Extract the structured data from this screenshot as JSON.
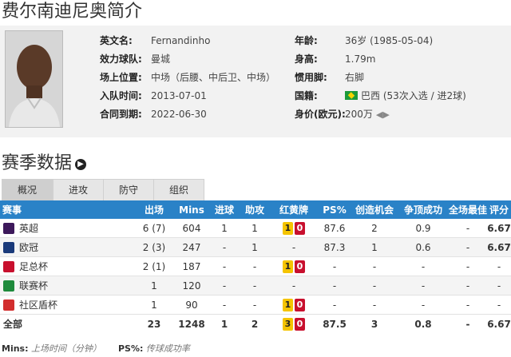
{
  "title": "费尔南迪尼奥简介",
  "profile": {
    "left": [
      {
        "label": "英文名:",
        "value": "Fernandinho"
      },
      {
        "label": "效力球队:",
        "value": "曼城"
      },
      {
        "label": "场上位置:",
        "value": "中场（后腰、中后卫、中场）"
      },
      {
        "label": "入队时间:",
        "value": "2013-07-01"
      },
      {
        "label": "合同到期:",
        "value": "2022-06-30"
      }
    ],
    "right": {
      "age": {
        "label": "年龄:",
        "value": "36岁 (1985-05-04)"
      },
      "height": {
        "label": "身高:",
        "value": "1.79m"
      },
      "foot": {
        "label": "惯用脚:",
        "value": "右脚"
      },
      "nation": {
        "label": "国籍:",
        "value": "巴西 (53次入选 / 进2球)"
      },
      "market": {
        "label": "身价(欧元):",
        "value": "200万"
      }
    },
    "flag_colors": {
      "green": "#1c9a3a",
      "yellow": "#f5d300"
    }
  },
  "season": {
    "title": "赛季数据",
    "tabs": [
      "概况",
      "进攻",
      "防守",
      "组织"
    ],
    "active_tab": 0,
    "headers": [
      "赛事",
      "出场",
      "Mins",
      "进球",
      "助攻",
      "红黄牌",
      "PS%",
      "创造机会",
      "争顶成功",
      "全场最佳",
      "评分"
    ],
    "rows": [
      {
        "comp": "英超",
        "icon": "premier-league-icon",
        "icon_color": "#3d195b",
        "apps": "6 (7)",
        "mins": "604",
        "goals": "1",
        "assists": "1",
        "yellow": "1",
        "red": "0",
        "ps": "87.6",
        "chances": "2",
        "aerial": "0.9",
        "motm": "-",
        "rating": "6.67"
      },
      {
        "comp": "欧冠",
        "icon": "champions-league-icon",
        "icon_color": "#1a3a7a",
        "apps": "2 (3)",
        "mins": "247",
        "goals": "-",
        "assists": "1",
        "yellow": "",
        "red": "",
        "card_text": "-",
        "ps": "87.3",
        "chances": "1",
        "aerial": "0.6",
        "motm": "-",
        "rating": "6.67"
      },
      {
        "comp": "足总杯",
        "icon": "fa-cup-icon",
        "icon_color": "#c8102e",
        "apps": "2 (1)",
        "mins": "187",
        "goals": "-",
        "assists": "-",
        "yellow": "1",
        "red": "0",
        "ps": "-",
        "chances": "-",
        "aerial": "-",
        "motm": "-",
        "rating": "-"
      },
      {
        "comp": "联赛杯",
        "icon": "league-cup-icon",
        "icon_color": "#1e8a3c",
        "apps": "1",
        "mins": "120",
        "goals": "-",
        "assists": "-",
        "yellow": "",
        "red": "",
        "card_text": "-",
        "ps": "-",
        "chances": "-",
        "aerial": "-",
        "motm": "-",
        "rating": "-"
      },
      {
        "comp": "社区盾杯",
        "icon": "community-shield-icon",
        "icon_color": "#d22e2e",
        "apps": "1",
        "mins": "90",
        "goals": "-",
        "assists": "-",
        "yellow": "1",
        "red": "0",
        "ps": "-",
        "chances": "-",
        "aerial": "-",
        "motm": "-",
        "rating": "-"
      }
    ],
    "total": {
      "comp": "全部",
      "apps": "23",
      "mins": "1248",
      "goals": "1",
      "assists": "2",
      "yellow": "3",
      "red": "0",
      "ps": "87.5",
      "chances": "3",
      "aerial": "0.8",
      "motm": "-",
      "rating": "6.67"
    }
  },
  "legend": {
    "mins_key": "Mins:",
    "mins_desc": "上场时间（分钟）",
    "ps_key": "PS%:",
    "ps_desc": "传球成功率"
  },
  "colors": {
    "header_blue": "#2a82c7",
    "rating_orange": "#e05a12",
    "yellow_card": "#f5c400",
    "red_card": "#c8102e"
  }
}
